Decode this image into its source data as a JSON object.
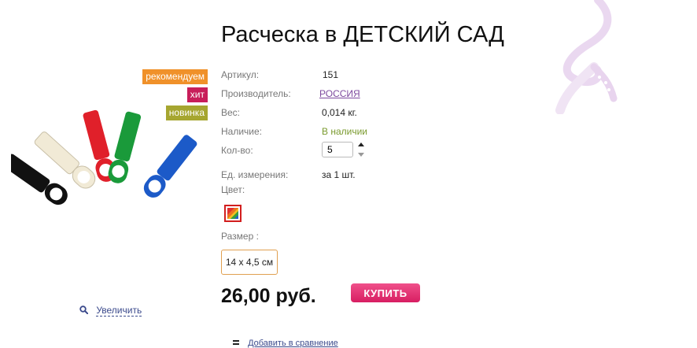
{
  "product": {
    "title": "Расческа в ДЕТСКИЙ САД",
    "badges": {
      "recommend": "рекомендуем",
      "hit": "хит",
      "new": "новинка"
    },
    "properties": {
      "article_label": "Артикул:",
      "article_value": "151",
      "manufacturer_label": "Производитель:",
      "manufacturer_value": "РОССИЯ",
      "weight_label": "Вес:",
      "weight_value": "0,014 кг.",
      "availability_label": "Наличие:",
      "availability_value": "В наличии",
      "quantity_label": "Кол-во:",
      "quantity_value": "5",
      "unit_label": "Ед. измерения:",
      "unit_value": "за 1 шт.",
      "color_label": "Цвет:",
      "size_label": "Размер :",
      "size_option": "14 x 4,5 см"
    },
    "price": "26,00 руб.",
    "buy_label": "КУПИТЬ",
    "zoom_label": "Увеличить",
    "compare_label": "Добавить в сравнение"
  },
  "colors": {
    "badge_recommend": "#f0912a",
    "badge_hit": "#c81e5a",
    "badge_new": "#a6a630",
    "buy_button": "#e2336f",
    "in_stock": "#7a9a2e",
    "link": "#7e4a9e"
  },
  "icons": {
    "zoom": "magnifier-icon",
    "compare": "compare-icon",
    "qty_stepper": "stepper-arrows-icon"
  }
}
